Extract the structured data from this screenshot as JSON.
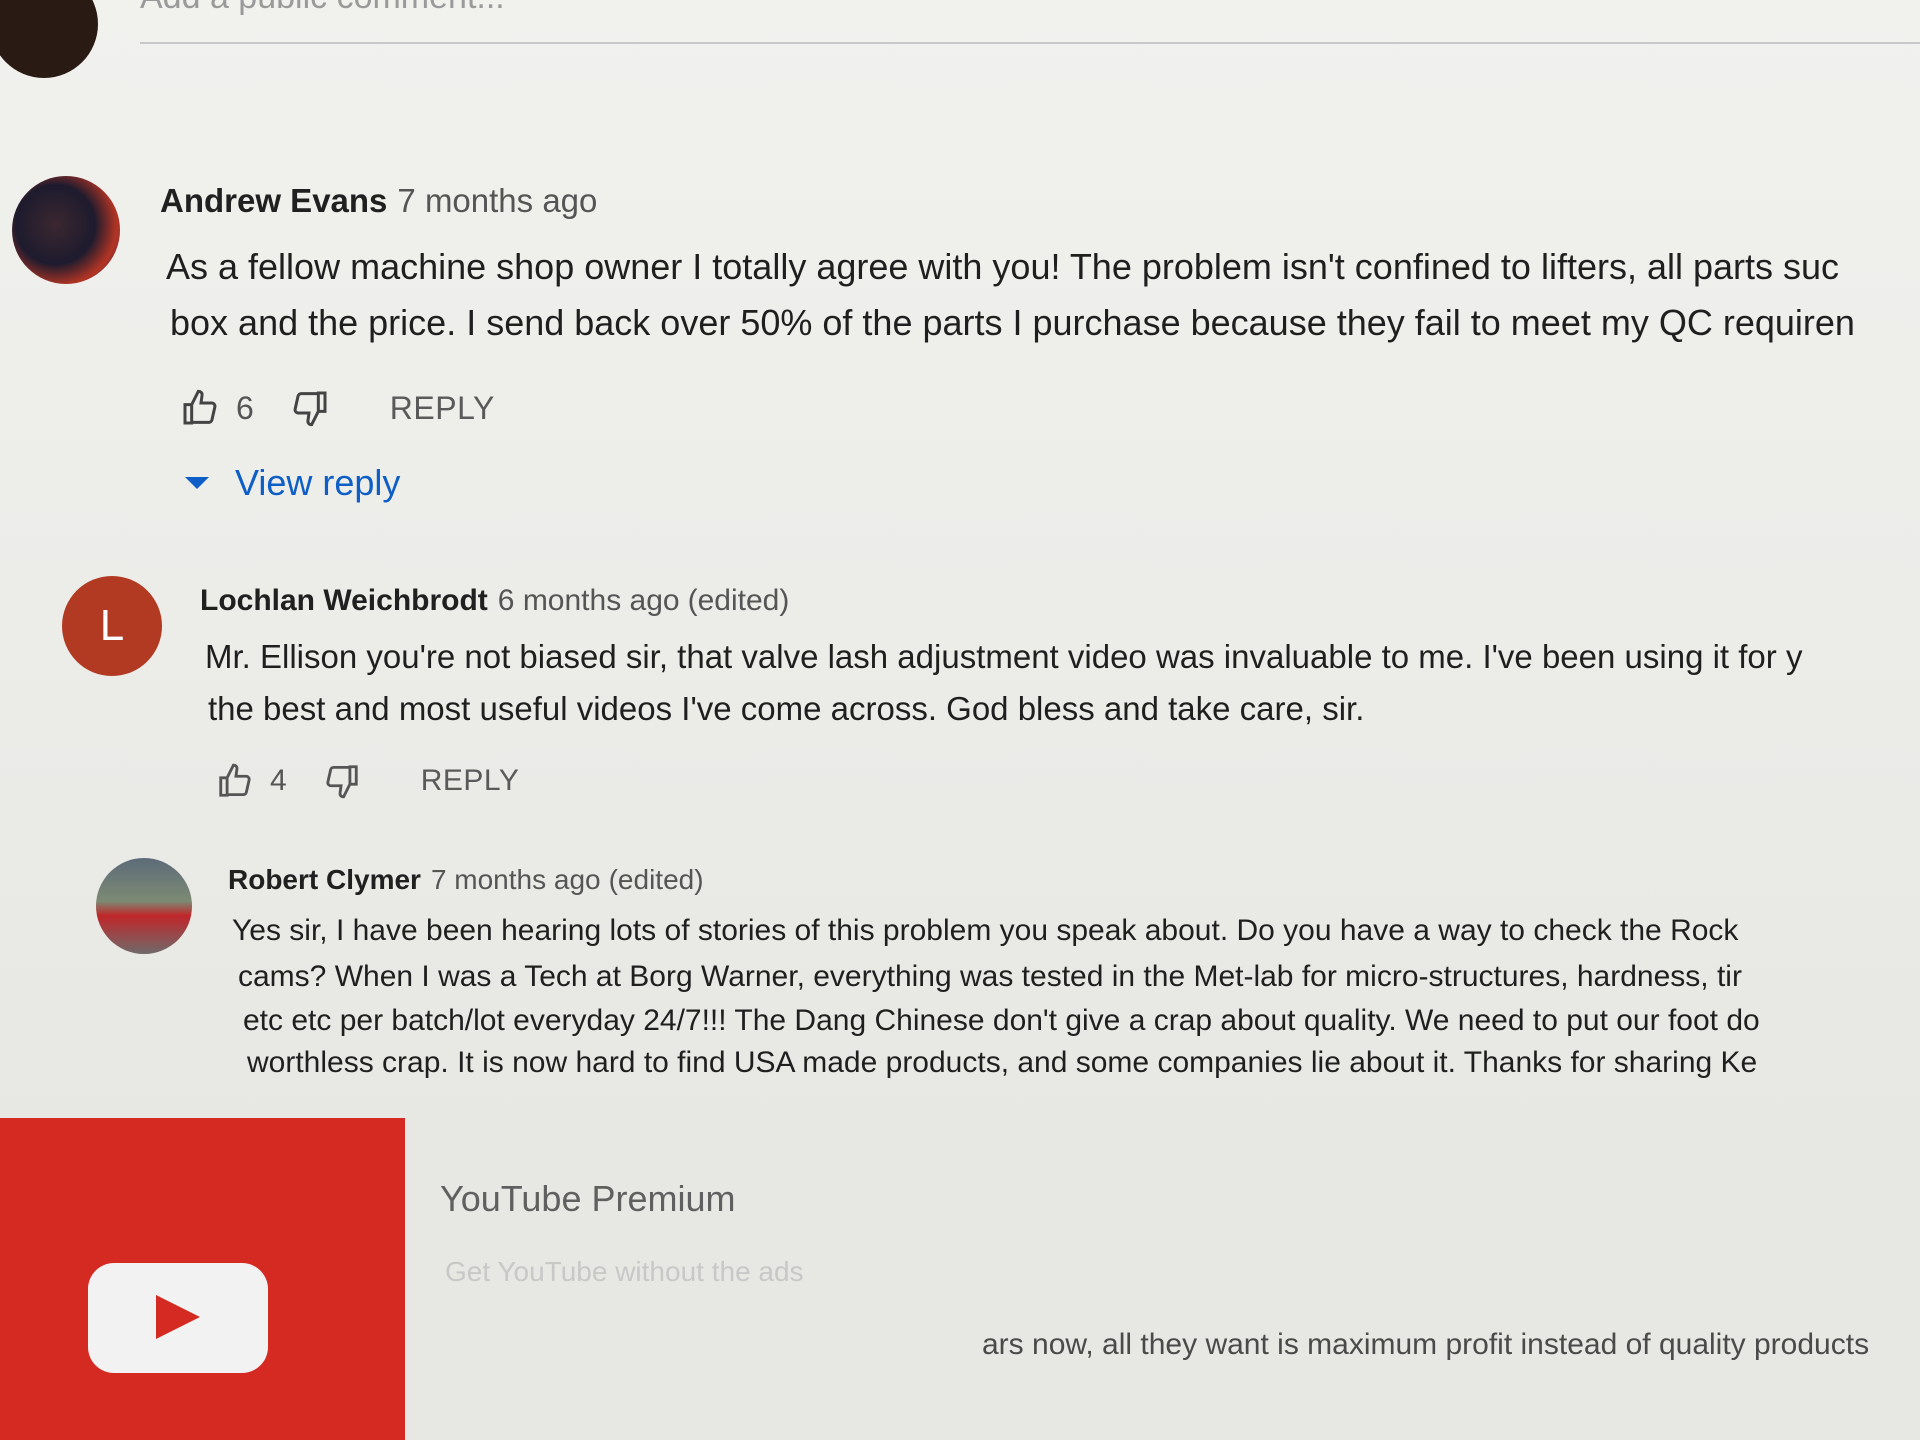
{
  "add_comment": {
    "placeholder": "Add a public comment..."
  },
  "comments": [
    {
      "author": "Andrew Evans",
      "time": "7 months ago",
      "edited": "",
      "lines": [
        "As a fellow machine shop owner I totally agree with you!  The problem isn't confined to lifters, all parts suc",
        "box and the price.   I send back over 50% of the parts I purchase because they fail to meet my QC requiren"
      ],
      "likes": "6",
      "reply_label": "REPLY",
      "view_reply_label": "View reply"
    },
    {
      "author": "Lochlan Weichbrodt",
      "avatar_letter": "L",
      "time": "6 months ago",
      "edited": "(edited)",
      "lines": [
        "Mr. Ellison you're not biased sir, that valve lash adjustment video was invaluable to me. I've been using it for y",
        "the best and most useful videos I've come across. God bless and take care, sir."
      ],
      "likes": "4",
      "reply_label": "REPLY"
    },
    {
      "author": "Robert Clymer",
      "time": "7 months ago",
      "edited": "(edited)",
      "lines": [
        "Yes sir, I have been hearing lots of stories of this problem you speak about. Do you have a way to check the Rock",
        "cams? When I was a Tech at Borg Warner, everything was tested in the Met-lab for micro-structures, hardness, tir",
        "etc etc per batch/lot everyday 24/7!!! The Dang Chinese don't give a crap about quality. We need to put our foot do",
        "worthless crap. It is now hard to find USA made products, and some companies lie about it. Thanks for sharing Ke"
      ]
    }
  ],
  "promo": {
    "title": "YouTube Premium",
    "subtitle": "Get YouTube without the ads",
    "overflow_text": "ars now, all they want is maximum profit instead of quality products"
  },
  "colors": {
    "link_blue": "#0d5ec7",
    "youtube_red": "#d52a22"
  },
  "icons": [
    "thumbs-up-icon",
    "thumbs-down-icon",
    "caret-down-icon",
    "youtube-play-icon"
  ]
}
